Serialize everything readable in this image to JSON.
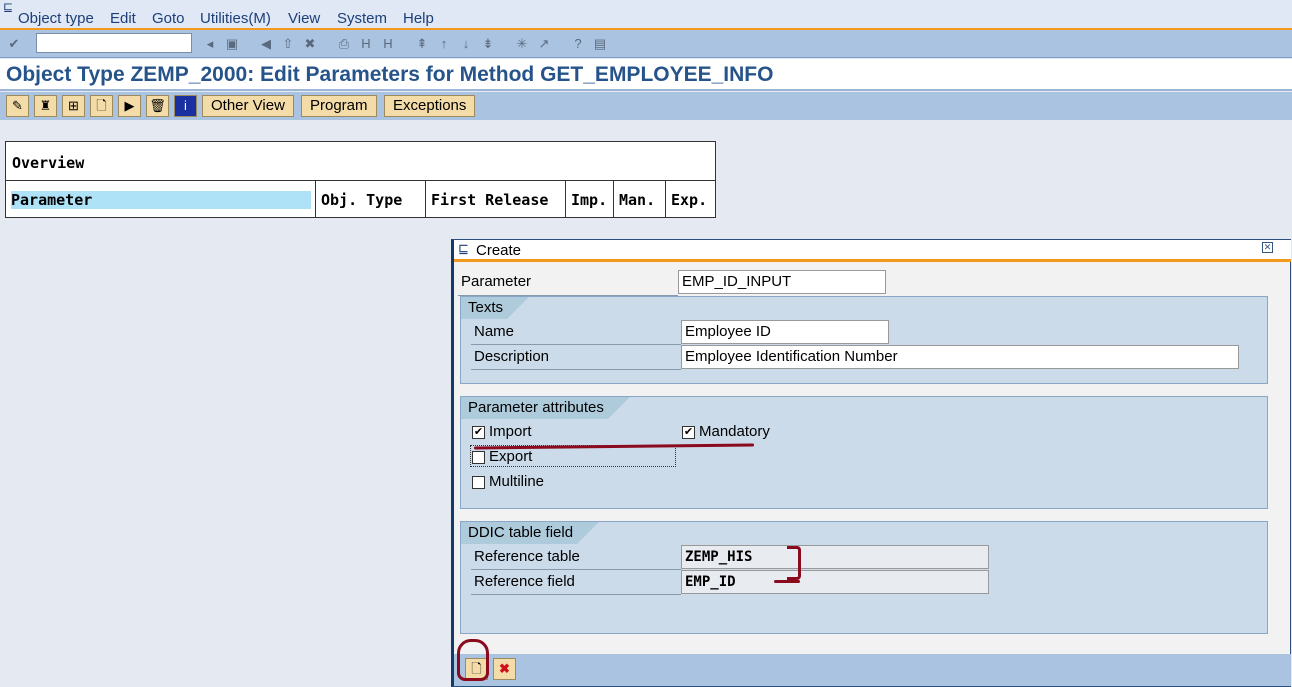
{
  "menu": [
    "Object type",
    "Edit",
    "Goto",
    "Utilities(M)",
    "View",
    "System",
    "Help"
  ],
  "title": "Object Type ZEMP_2000: Edit Parameters for Method GET_EMPLOYEE_INFO",
  "app_toolbar": {
    "other_view": "Other View",
    "program": "Program",
    "exceptions": "Exceptions"
  },
  "overview": {
    "heading": "Overview",
    "columns": [
      "Parameter",
      "Obj. Type",
      "First Release",
      "Imp.",
      "Man.",
      "Exp."
    ]
  },
  "dialog": {
    "title": "Create",
    "parameter_label": "Parameter",
    "parameter_value": "EMP_ID_INPUT",
    "texts": {
      "title": "Texts",
      "name_label": "Name",
      "name_value": "Employee ID",
      "desc_label": "Description",
      "desc_value": "Employee Identification Number"
    },
    "attributes": {
      "title": "Parameter attributes",
      "import": "Import",
      "mandatory": "Mandatory",
      "export": "Export",
      "multiline": "Multiline",
      "import_checked": true,
      "mandatory_checked": true,
      "export_checked": false,
      "multiline_checked": false
    },
    "ddic": {
      "title": "DDIC table field",
      "ref_table_label": "Reference table",
      "ref_table_value": "ZEMP_HIS",
      "ref_field_label": "Reference field",
      "ref_field_value": "EMP_ID"
    }
  },
  "colors": {
    "accent": "#f39a1e",
    "title": "#26548a",
    "annotation": "#8b0a1e"
  }
}
